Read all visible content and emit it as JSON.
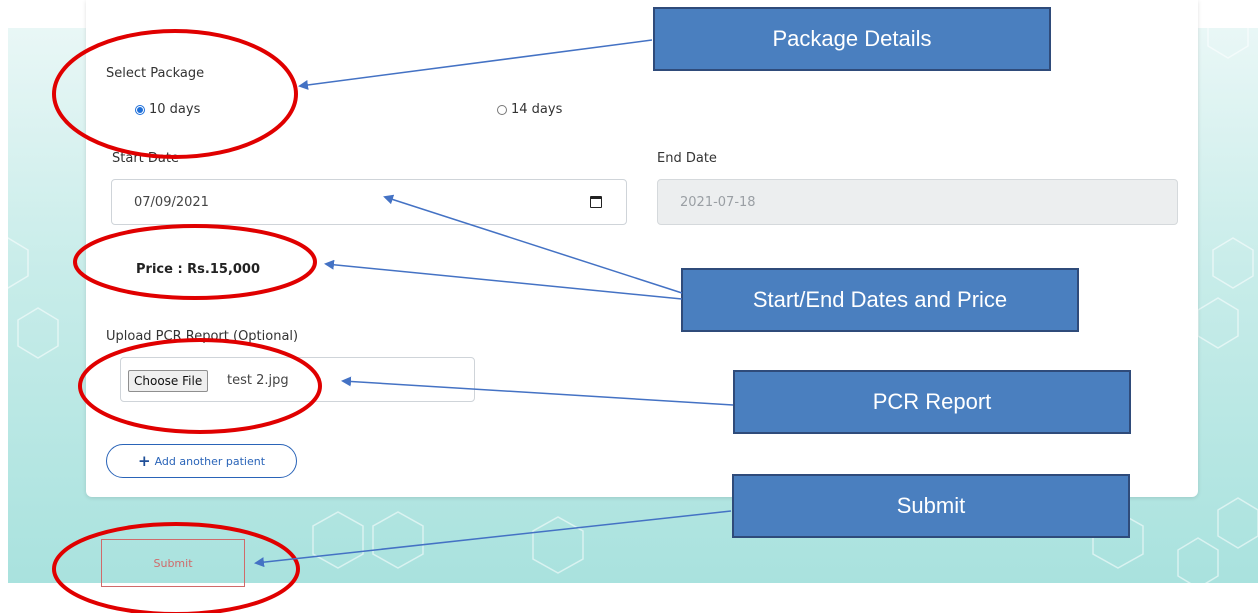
{
  "form": {
    "select_package_label": "Select Package",
    "package_options": [
      {
        "label": "10 days",
        "selected": true
      },
      {
        "label": "14 days",
        "selected": false
      }
    ],
    "start_date_label": "Start Date",
    "start_date_value": "07/09/2021",
    "end_date_label": "End Date",
    "end_date_value": "2021-07-18",
    "price_text": "Price : Rs.15,000",
    "upload_label": "Upload PCR Report (Optional)",
    "choose_file_label": "Choose File",
    "file_name": "test 2.jpg",
    "add_patient_label": "Add another patient",
    "submit_label": "Submit"
  },
  "annotations": {
    "callouts": [
      {
        "text": "Package Details"
      },
      {
        "text": "Start/End Dates and Price"
      },
      {
        "text": "PCR Report"
      },
      {
        "text": "Submit"
      }
    ],
    "highlight_color": "#e00000",
    "arrow_color": "#4472c4",
    "callout_color": "#4a7fbf"
  },
  "icons": {
    "calendar": "calendar-icon",
    "plus": "plus-icon"
  }
}
